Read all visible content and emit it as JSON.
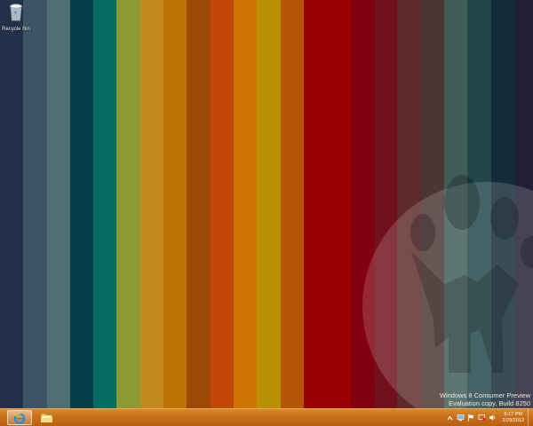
{
  "desktop": {
    "stripe_colors": [
      "#23304a",
      "#3d5468",
      "#4f6e72",
      "#033c48",
      "#056a62",
      "#8c9a34",
      "#c28a1e",
      "#bc7306",
      "#9c4908",
      "#c24606",
      "#d07404",
      "#b89204",
      "#b65406",
      "#990006",
      "#980006",
      "#820010",
      "#72101c",
      "#5e2a2b",
      "#4c3634",
      "#3f5c57",
      "#224649",
      "#142c38",
      "#231f36"
    ],
    "icons": [
      {
        "label": "Recycle Bin",
        "icon": "recycle-bin-icon"
      }
    ],
    "watermark": {
      "line1": "Windows 8 Consumer Preview",
      "line2": "Evaluation copy. Build 8250"
    }
  },
  "taskbar": {
    "pinned": [
      {
        "name": "internet-explorer",
        "icon": "internet-explorer-icon",
        "active": true
      },
      {
        "name": "file-explorer",
        "icon": "folder-icon",
        "active": false
      }
    ],
    "tray": {
      "icons": [
        "show-hidden-icons-chevron",
        "network-icon",
        "action-center-flag-icon",
        "display-icon",
        "volume-icon"
      ],
      "time": "6:17 PM",
      "date": "2/29/2012"
    }
  }
}
